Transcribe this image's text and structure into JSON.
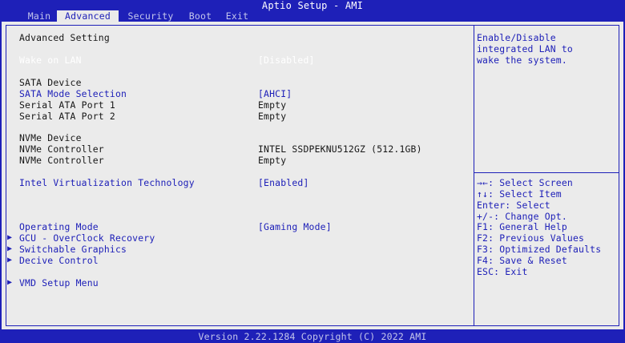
{
  "title": "Aptio Setup - AMI",
  "tabs": [
    "Main",
    "Advanced",
    "Security",
    "Boot",
    "Exit"
  ],
  "section_title": "Advanced Setting",
  "settings": {
    "wake_on_lan": {
      "label": "Wake on LAN",
      "value": "[Disabled]"
    },
    "sata_header": "SATA Device",
    "sata_mode": {
      "label": "SATA Mode Selection",
      "value": "[AHCI]"
    },
    "sata_port1": {
      "label": "Serial ATA Port 1",
      "value": "Empty"
    },
    "sata_port2": {
      "label": "Serial ATA Port 2",
      "value": "Empty"
    },
    "nvme_header": "NVMe Device",
    "nvme_ctrl1": {
      "label": "NVMe Controller",
      "value": "INTEL SSDPEKNU512GZ (512.1GB)"
    },
    "nvme_ctrl2": {
      "label": "NVMe Controller",
      "value": "Empty"
    },
    "virtualization": {
      "label": "Intel Virtualization Technology",
      "value": "[Enabled]"
    },
    "operating_mode": {
      "label": "Operating Mode",
      "value": "[Gaming Mode]"
    },
    "gcu": {
      "label": "GCU - OverClock Recovery"
    },
    "switchable": {
      "label": "Switchable Graphics"
    },
    "device_control": {
      "label": "Decive Control"
    },
    "vmd": {
      "label": "VMD Setup Menu"
    }
  },
  "submenu_arrow": "▶",
  "help_text": [
    "Enable/Disable",
    "integrated LAN to",
    "wake the system."
  ],
  "key_help": [
    "→←: Select Screen",
    "↑↓: Select Item",
    "Enter: Select",
    "+/-: Change Opt.",
    "F1: General Help",
    "F2: Previous Values",
    "F3: Optimized Defaults",
    "F4: Save & Reset",
    "ESC: Exit"
  ],
  "footer": "Version 2.22.1284 Copyright (C) 2022 AMI",
  "colors": {
    "background": "#1e20b8",
    "panel": "#ebebeb",
    "active_tab": "#eaeaea",
    "text": "#161616",
    "selected": "#ffffff"
  }
}
